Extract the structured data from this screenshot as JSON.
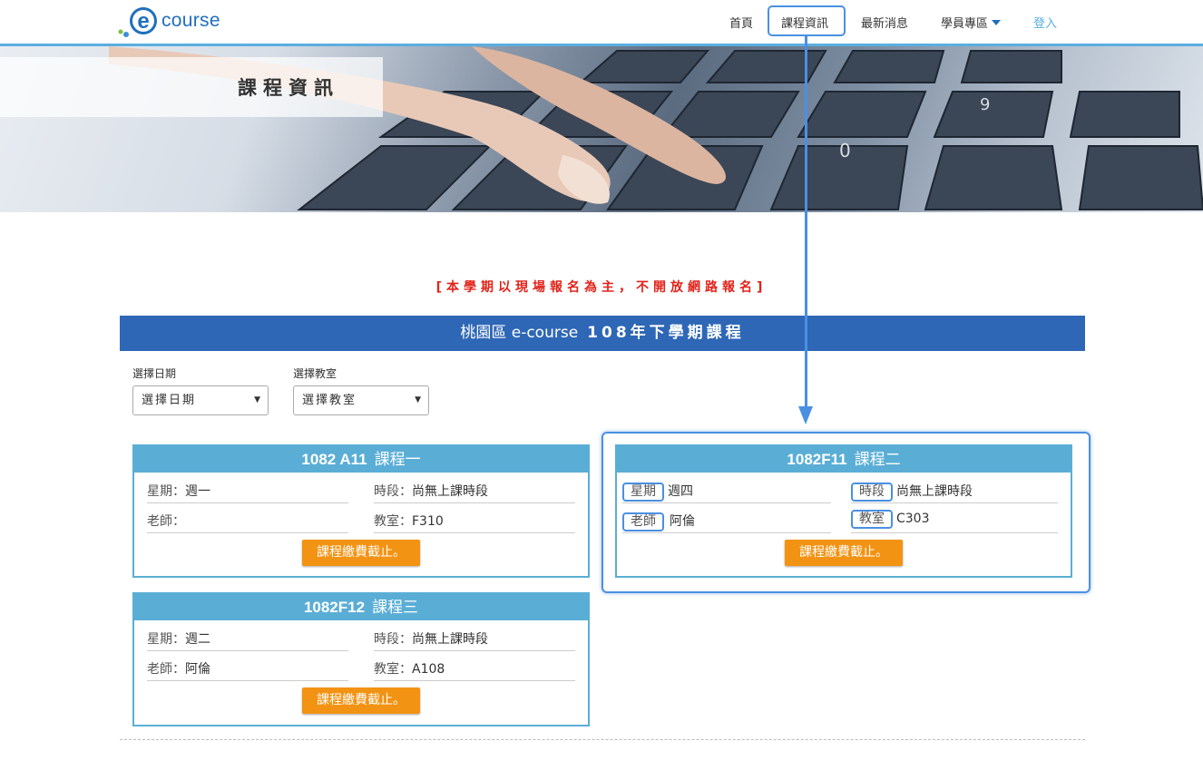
{
  "brand": {
    "logo_text": "course"
  },
  "nav": {
    "home": "首頁",
    "course_info": "課程資訊",
    "news": "最新消息",
    "student_area": "學員專區",
    "login": "登入"
  },
  "banner": {
    "title": "課程資訊"
  },
  "notice": "[本學期以現場報名為主，不開放網路報名]",
  "titlebar": {
    "region": "桃園區 e-course",
    "term": "108年下學期課程"
  },
  "filters": {
    "date_label": "選擇日期",
    "date_value": "選擇日期",
    "room_label": "選擇教室",
    "room_value": "選擇教室"
  },
  "courses": [
    {
      "code": "1082 A11",
      "name": "課程一",
      "weekday_label": "星期：",
      "weekday": "週一",
      "period_label": "時段：",
      "period": "尚無上課時段",
      "teacher_label": "老師：",
      "teacher": "",
      "room_label": "教室：",
      "room": "F310",
      "button": "課程繳費截止。"
    },
    {
      "code": "1082F11",
      "name": "課程二",
      "weekday_label": "星期",
      "weekday": "週四",
      "period_label": "時段",
      "period": "尚無上課時段",
      "teacher_label": "老師",
      "teacher": "阿倫",
      "room_label": "教室",
      "room": "C303",
      "button": "課程繳費截止。"
    },
    {
      "code": "1082F12",
      "name": "課程三",
      "weekday_label": "星期：",
      "weekday": "週二",
      "period_label": "時段：",
      "period": "尚無上課時段",
      "teacher_label": "老師：",
      "teacher": "阿倫",
      "room_label": "教室：",
      "room": "A108",
      "button": "課程繳費截止。"
    }
  ],
  "colors": {
    "brand_blue": "#2e67b6",
    "card_blue": "#5aaed6",
    "button_orange": "#f39313",
    "notice_red": "#e2231a",
    "highlight": "#4a90e2"
  }
}
